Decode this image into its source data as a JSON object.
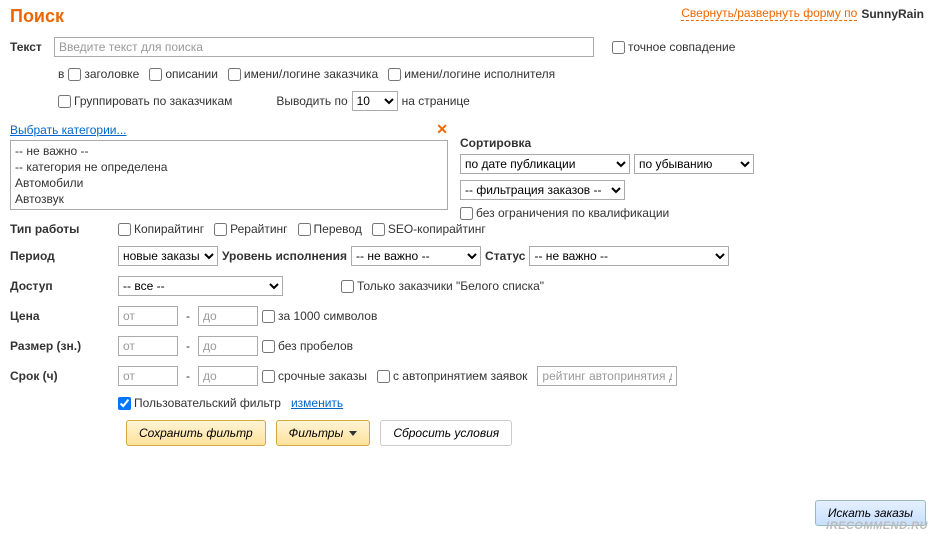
{
  "header": {
    "title": "Поиск",
    "toggle": "Свернуть/развернуть форму по",
    "user": "SunnyRain"
  },
  "text_row": {
    "label": "Текст",
    "placeholder": "Введите текст для поиска",
    "exact": "точное совпадение"
  },
  "in_row": {
    "prefix": "в",
    "title": "заголовке",
    "desc": "описании",
    "cust": "имени/логине заказчика",
    "exec": "имени/логине исполнителя"
  },
  "group_row": {
    "group": "Группировать по заказчикам",
    "output": "Выводить по",
    "per": "10",
    "suffix": "на странице"
  },
  "cats_link": "Выбрать категории...",
  "cat_list": [
    "-- не важно --",
    "-- категория не определена",
    "Автомобили",
    " Автозвук"
  ],
  "sort": {
    "title": "Сортировка",
    "by": "по дате публикации",
    "dir": "по убыванию",
    "filter": "-- фильтрация заказов --",
    "qual": "без ограничения по квалификации"
  },
  "work": {
    "label": "Тип работы",
    "copy": "Копирайтинг",
    "rew": "Рерайтинг",
    "tr": "Перевод",
    "seo": "SEO-копирайтинг"
  },
  "period": {
    "label": "Период",
    "val": "новые заказы",
    "lvl_label": "Уровень исполнения",
    "lvl": "-- не важно --",
    "st_label": "Статус",
    "st": "-- не важно --"
  },
  "access": {
    "label": "Доступ",
    "val": "-- все --",
    "white": "Только заказчики \"Белого списка\""
  },
  "price": {
    "label": "Цена",
    "from": "от",
    "to": "до",
    "per1k": "за 1000 символов"
  },
  "size": {
    "label": "Размер (зн.)",
    "from": "от",
    "to": "до",
    "nosp": "без пробелов"
  },
  "term": {
    "label": "Срок (ч)",
    "from": "от",
    "to": "до",
    "urgent": "срочные заказы",
    "auto": "с автопринятием заявок",
    "rating_ph": "рейтинг автопринятия д"
  },
  "userf": {
    "label": "Пользовательский фильтр",
    "change": "изменить"
  },
  "buttons": {
    "save": "Сохранить фильтр",
    "filters": "Фильтры",
    "reset": "Сбросить условия",
    "search": "Искать заказы"
  },
  "watermark": "IRECOMMEND.RU"
}
